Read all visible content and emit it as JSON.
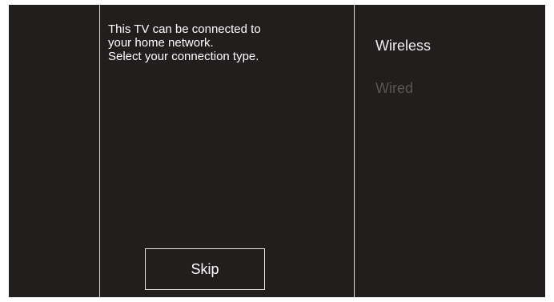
{
  "setup": {
    "message_lines": [
      "This TV can be connected to",
      "your home network.",
      "Select your connection type."
    ],
    "options": [
      {
        "label": "Wireless",
        "state": "highlighted"
      },
      {
        "label": "Wired",
        "state": "dimmed"
      }
    ],
    "skip_label": "Skip"
  },
  "colors": {
    "background": "#221e1e",
    "text": "#ffffff",
    "dimmed_text": "#5a5656",
    "divider": "#d8d8d8"
  }
}
